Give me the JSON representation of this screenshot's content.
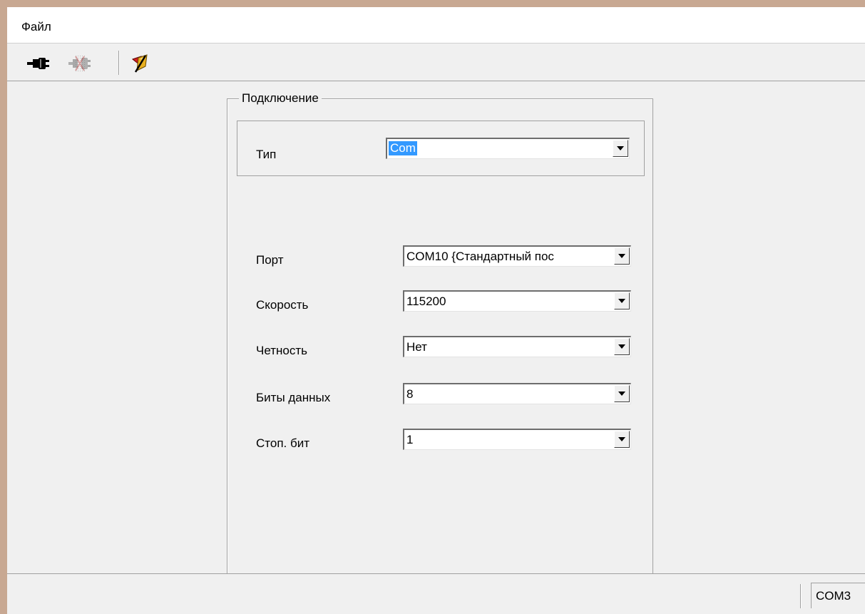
{
  "menu": {
    "file_label": "Файл"
  },
  "toolbar": {
    "icons": [
      "connect-plug-icon",
      "disconnect-plug-icon",
      "flag-icon"
    ]
  },
  "connection": {
    "group_title": "Подключение",
    "type_label": "Тип",
    "type_value": "Com",
    "port_label": "Порт",
    "port_value": "COM10 {Стандартный пос",
    "speed_label": "Скорость",
    "speed_value": "115200",
    "parity_label": "Четность",
    "parity_value": "Нет",
    "databits_label": "Биты данных",
    "databits_value": "8",
    "stopbits_label": "Стоп. бит",
    "stopbits_value": "1"
  },
  "status": {
    "port": "COM3"
  },
  "colors": {
    "selection": "#3399ff",
    "window_bg": "#f0f0f0",
    "frame": "#c8a892"
  }
}
